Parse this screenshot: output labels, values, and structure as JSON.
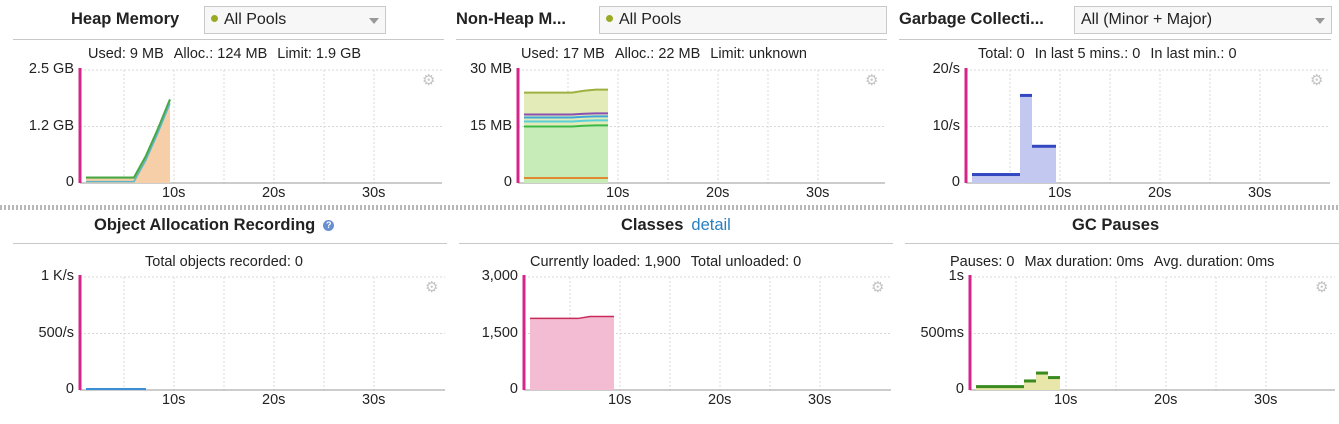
{
  "panels": {
    "heap": {
      "title": "Heap Memory",
      "dropdown": "All Pools",
      "stats": [
        "Used: 9 MB",
        "Alloc.: 124 MB",
        "Limit: 1.9 GB"
      ],
      "y_ticks": [
        "2.5 GB",
        "1.2 GB",
        "0"
      ],
      "x_ticks": [
        "10s",
        "20s",
        "30s"
      ]
    },
    "nonheap": {
      "title": "Non-Heap M...",
      "dropdown": "All Pools",
      "stats": [
        "Used: 17 MB",
        "Alloc.: 22 MB",
        "Limit: unknown"
      ],
      "y_ticks": [
        "30 MB",
        "15 MB",
        "0"
      ],
      "x_ticks": [
        "10s",
        "20s",
        "30s"
      ]
    },
    "gc": {
      "title": "Garbage Collecti...",
      "dropdown": "All (Minor + Major)",
      "stats": [
        "Total: 0",
        "In last 5 mins.: 0",
        "In last min.: 0"
      ],
      "y_ticks": [
        "20/s",
        "10/s",
        "0"
      ],
      "x_ticks": [
        "10s",
        "20s",
        "30s"
      ]
    },
    "alloc": {
      "title": "Object Allocation Recording",
      "stats": [
        "Total objects recorded: 0"
      ],
      "y_ticks": [
        "1 K/s",
        "500/s",
        "0"
      ],
      "x_ticks": [
        "10s",
        "20s",
        "30s"
      ]
    },
    "classes": {
      "title": "Classes",
      "link": "detail",
      "stats": [
        "Currently loaded: 1,900",
        "Total unloaded: 0"
      ],
      "y_ticks": [
        "3,000",
        "1,500",
        "0"
      ],
      "x_ticks": [
        "10s",
        "20s",
        "30s"
      ]
    },
    "gcpauses": {
      "title": "GC Pauses",
      "stats": [
        "Pauses: 0",
        "Max duration: 0ms",
        "Avg. duration: 0ms"
      ],
      "y_ticks": [
        "1s",
        "500ms",
        "0"
      ],
      "x_ticks": [
        "10s",
        "20s",
        "30s"
      ]
    }
  },
  "colors": {
    "marker": "#d6248a",
    "heap_fill": "#f6cfa8",
    "nonheap_fill": "#c8ecb8",
    "gc_fill": "#c3c8f0",
    "classes_fill": "#f3bcd2",
    "alloc_line": "#3a8fd8"
  },
  "chart_data": [
    {
      "type": "area",
      "panel": "Heap Memory",
      "x": [
        1,
        2,
        3,
        4,
        5,
        6,
        7,
        8
      ],
      "series": [
        {
          "values": [
            0.12,
            0.12,
            0.12,
            0.12,
            0.12,
            0.6,
            1.2,
            1.85
          ]
        }
      ],
      "ylim": [
        0,
        2.5
      ],
      "xlabel": "",
      "ylabel": ""
    },
    {
      "type": "area",
      "panel": "Non-Heap Memory",
      "x": [
        1,
        2,
        3,
        4,
        5,
        6,
        7,
        8
      ],
      "series": [
        {
          "values": [
            24,
            24,
            24,
            24,
            24,
            24.5,
            24.8,
            24.8
          ]
        },
        {
          "values": [
            15,
            15,
            15,
            15,
            15,
            15.2,
            15.3,
            15.3
          ]
        }
      ],
      "ylim": [
        0,
        30
      ]
    },
    {
      "type": "bar",
      "panel": "Garbage Collection",
      "x": [
        1,
        2,
        3,
        4,
        5,
        6,
        7,
        8
      ],
      "values": [
        1.5,
        1.5,
        1.5,
        1.5,
        15.5,
        6.5,
        6.5,
        0
      ],
      "ylim": [
        0,
        20
      ]
    },
    {
      "type": "line",
      "panel": "Object Allocation Recording",
      "x": [
        1,
        8
      ],
      "values": [
        0,
        0
      ],
      "ylim": [
        0,
        1000
      ]
    },
    {
      "type": "area",
      "panel": "Classes",
      "x": [
        1,
        2,
        3,
        4,
        5,
        6,
        7,
        8
      ],
      "values": [
        1900,
        1900,
        1900,
        1900,
        1900,
        1950,
        1950,
        1950
      ],
      "ylim": [
        0,
        3000
      ]
    },
    {
      "type": "bar",
      "panel": "GC Pauses",
      "x": [
        1,
        2,
        3,
        4,
        5,
        6,
        7,
        8
      ],
      "values": [
        30,
        30,
        30,
        30,
        80,
        150,
        110,
        0
      ],
      "ylim": [
        0,
        1000
      ]
    }
  ]
}
